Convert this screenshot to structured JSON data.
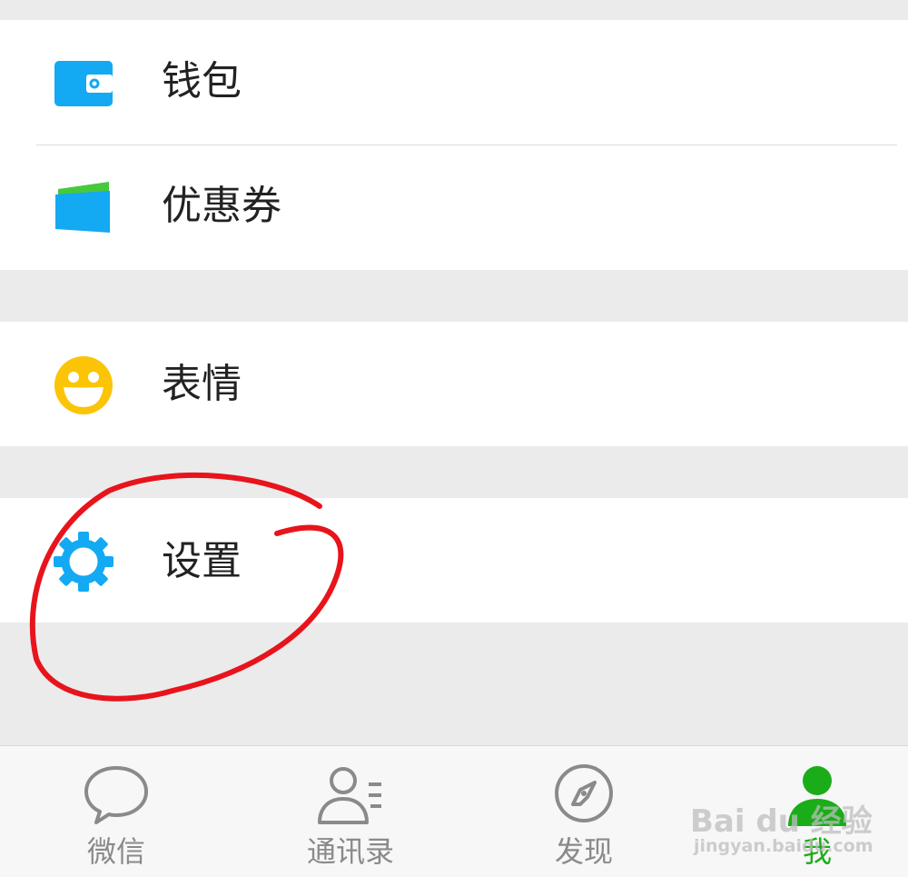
{
  "menu": {
    "wallet_label": "钱包",
    "coupons_label": "优惠券",
    "stickers_label": "表情",
    "settings_label": "设置"
  },
  "tabbar": {
    "chats_label": "微信",
    "contacts_label": "通讯录",
    "discover_label": "发现",
    "me_label": "我"
  },
  "watermark": {
    "brand": "Bai du 经验",
    "site": "jingyan.baidu.com"
  },
  "colors": {
    "accent_blue": "#13a9f3",
    "active_green": "#1aad19",
    "annotation_red": "#e8141c",
    "smiley_yellow": "#fbc406"
  },
  "icons": {
    "wallet": "wallet-icon",
    "coupons": "coupon-icon",
    "stickers": "smiley-icon",
    "settings": "gear-icon",
    "chats": "chat-bubble-icon",
    "contacts": "contacts-icon",
    "discover": "compass-icon",
    "me": "person-icon"
  }
}
